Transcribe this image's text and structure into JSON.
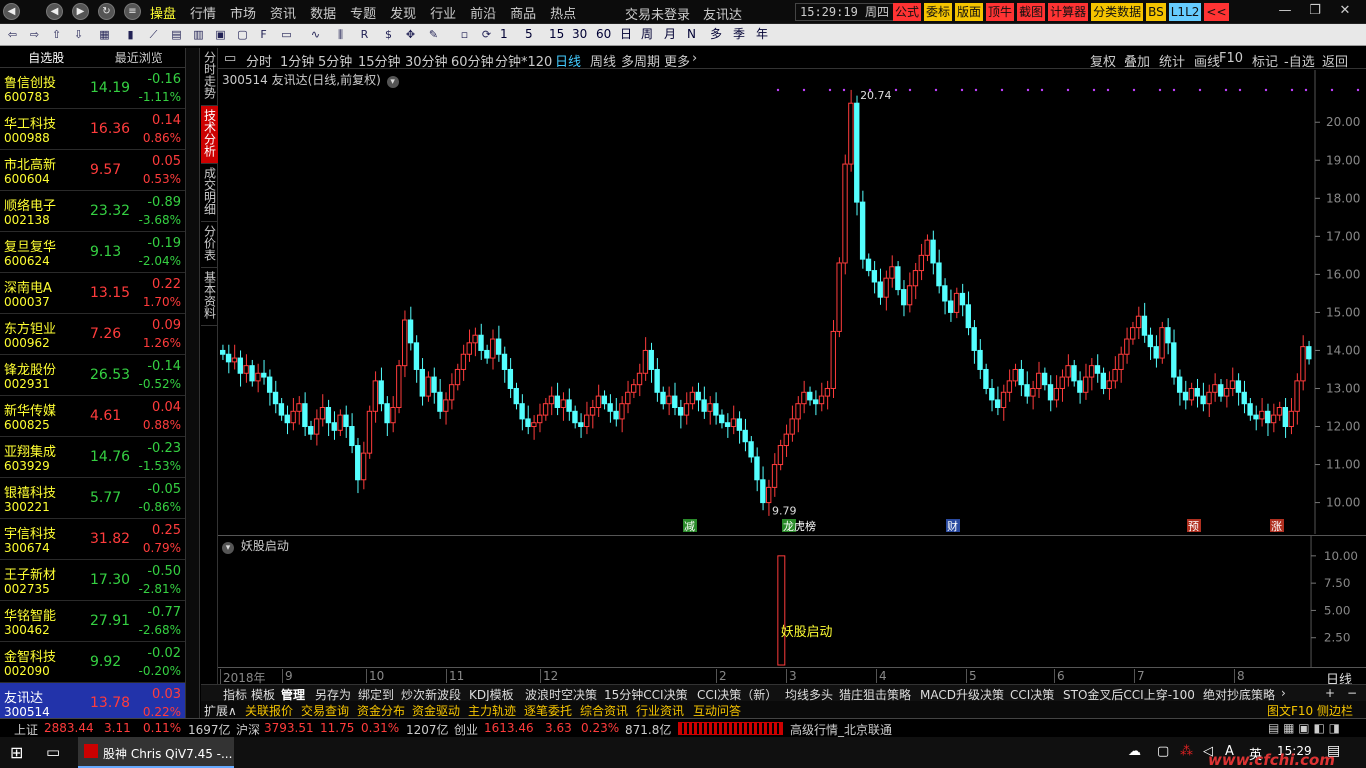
{
  "topmenu": {
    "items": [
      "操盘",
      "行情",
      "市场",
      "资讯",
      "数据",
      "专题",
      "发现",
      "行业",
      "前沿",
      "商品",
      "热点"
    ],
    "active": 0,
    "trade_status": "交易未登录",
    "stock_name": "友讯达",
    "clock": "15:29:19 周四",
    "quick": [
      "公式",
      "委标",
      "版面",
      "顶牛",
      "截图",
      "计算器",
      "分类数据",
      "BS",
      "L1L2",
      "<<"
    ]
  },
  "toolbar": {
    "text_items": [
      "1",
      "5",
      "15",
      "30",
      "60",
      "日",
      "周",
      "月",
      "N",
      "多",
      "季",
      "年"
    ]
  },
  "stocklist": {
    "header": [
      "自选股",
      "最近浏览"
    ],
    "rows": [
      {
        "name": "鲁信创投",
        "code": "600783",
        "price": "14.19",
        "change": "-0.16",
        "pct": "-1.11%",
        "dir": "dn"
      },
      {
        "name": "华工科技",
        "code": "000988",
        "price": "16.36",
        "change": "0.14",
        "pct": "0.86%",
        "dir": "up"
      },
      {
        "name": "市北高新",
        "code": "600604",
        "price": "9.57",
        "change": "0.05",
        "pct": "0.53%",
        "dir": "up"
      },
      {
        "name": "顺络电子",
        "code": "002138",
        "price": "23.32",
        "change": "-0.89",
        "pct": "-3.68%",
        "dir": "dn"
      },
      {
        "name": "复旦复华",
        "code": "600624",
        "price": "9.13",
        "change": "-0.19",
        "pct": "-2.04%",
        "dir": "dn"
      },
      {
        "name": "深南电A",
        "code": "000037",
        "price": "13.15",
        "change": "0.22",
        "pct": "1.70%",
        "dir": "up"
      },
      {
        "name": "东方钽业",
        "code": "000962",
        "price": "7.26",
        "change": "0.09",
        "pct": "1.26%",
        "dir": "up"
      },
      {
        "name": "锋龙股份",
        "code": "002931",
        "price": "26.53",
        "change": "-0.14",
        "pct": "-0.52%",
        "dir": "dn"
      },
      {
        "name": "新华传媒",
        "code": "600825",
        "price": "4.61",
        "change": "0.04",
        "pct": "0.88%",
        "dir": "up"
      },
      {
        "name": "亚翔集成",
        "code": "603929",
        "price": "14.76",
        "change": "-0.23",
        "pct": "-1.53%",
        "dir": "dn"
      },
      {
        "name": "银禧科技",
        "code": "300221",
        "price": "5.77",
        "change": "-0.05",
        "pct": "-0.86%",
        "dir": "dn"
      },
      {
        "name": "宇信科技",
        "code": "300674",
        "price": "31.82",
        "change": "0.25",
        "pct": "0.79%",
        "dir": "up"
      },
      {
        "name": "王子新材",
        "code": "002735",
        "price": "17.30",
        "change": "-0.50",
        "pct": "-2.81%",
        "dir": "dn"
      },
      {
        "name": "华铭智能",
        "code": "300462",
        "price": "27.91",
        "change": "-0.77",
        "pct": "-2.68%",
        "dir": "dn"
      },
      {
        "name": "金智科技",
        "code": "002090",
        "price": "9.92",
        "change": "-0.02",
        "pct": "-0.20%",
        "dir": "dn"
      },
      {
        "name": "友讯达",
        "code": "300514",
        "price": "13.78",
        "change": "0.03",
        "pct": "0.22%",
        "dir": "up"
      }
    ],
    "selected": 15
  },
  "vtabs": [
    {
      "label": "分时走势",
      "active": false
    },
    {
      "label": "技术分析",
      "active": true
    },
    {
      "label": "成交明细",
      "active": false
    },
    {
      "label": "分价表",
      "active": false
    },
    {
      "label": "基本资料",
      "active": false
    }
  ],
  "periods": {
    "items": [
      "分时",
      "1分钟",
      "5分钟",
      "15分钟",
      "30分钟",
      "60分钟",
      "分钟*120",
      "日线",
      "周线",
      "多周期",
      "更多"
    ],
    "active": 7,
    "right_tools": [
      "复权",
      "叠加",
      "统计",
      "画线",
      "F10",
      "标记",
      "-自选",
      "返回"
    ]
  },
  "chart": {
    "title": "300514 友讯达(日线,前复权)",
    "sub_title": "妖股启动",
    "sub_label": "妖股启动",
    "max_label": "20.74",
    "min_label": "9.79",
    "markers": [
      {
        "text": "减",
        "x": 53,
        "color": "#2a8a2a"
      },
      {
        "text": "龙虎榜",
        "x": 152,
        "color": "#2a8a2a"
      },
      {
        "text": "财",
        "x": 316,
        "color": "#2a4aa0"
      },
      {
        "text": "预",
        "x": 557,
        "color": "#b03020"
      },
      {
        "text": "涨",
        "x": 640,
        "color": "#b03020"
      }
    ]
  },
  "chart_data": {
    "type": "candlestick",
    "ylim": [
      9.7,
      20.9
    ],
    "yticks": [
      "20.00",
      "19.00",
      "18.00",
      "17.00",
      "16.00",
      "15.00",
      "14.00",
      "13.00",
      "12.00",
      "11.00",
      "10.00"
    ],
    "sub_yticks": [
      "10.00",
      "7.50",
      "5.00",
      "2.50"
    ],
    "x_labels": [
      "2018年",
      "9",
      "10",
      "11",
      "12",
      "2",
      "3",
      "4",
      "5",
      "6",
      "7",
      "8"
    ],
    "close_path": [
      13.9,
      13.7,
      13.8,
      13.4,
      13.6,
      13.2,
      13.4,
      13.3,
      12.9,
      12.6,
      12.3,
      12.1,
      12.4,
      12.6,
      12.0,
      11.8,
      12.2,
      12.5,
      12.1,
      11.9,
      12.3,
      12.0,
      11.5,
      10.6,
      11.3,
      12.4,
      13.2,
      12.6,
      12.1,
      12.5,
      13.6,
      14.8,
      14.2,
      13.5,
      12.8,
      13.3,
      12.9,
      12.4,
      12.7,
      13.1,
      13.5,
      13.9,
      14.2,
      14.4,
      14.0,
      13.8,
      14.3,
      13.9,
      13.5,
      13.0,
      12.6,
      12.2,
      12.0,
      12.1,
      12.3,
      12.6,
      12.8,
      12.5,
      12.7,
      12.4,
      12.1,
      12.0,
      12.3,
      12.5,
      12.8,
      12.6,
      12.4,
      12.2,
      12.6,
      12.9,
      13.1,
      13.4,
      14.0,
      13.5,
      12.9,
      12.6,
      12.8,
      12.5,
      12.3,
      12.6,
      12.9,
      12.7,
      12.4,
      12.6,
      12.3,
      12.1,
      12.0,
      12.2,
      11.9,
      11.6,
      11.2,
      10.6,
      10.0,
      10.4,
      11.0,
      11.5,
      11.8,
      12.2,
      12.6,
      12.9,
      12.7,
      12.6,
      12.8,
      13.0,
      14.5,
      16.3,
      18.9,
      20.5,
      17.9,
      16.4,
      16.1,
      15.8,
      15.4,
      15.9,
      16.2,
      15.6,
      15.2,
      15.7,
      16.1,
      16.5,
      16.9,
      16.3,
      15.7,
      15.3,
      15.0,
      15.5,
      15.2,
      14.6,
      14.0,
      13.5,
      13.0,
      12.7,
      12.5,
      12.9,
      13.2,
      13.5,
      13.1,
      12.8,
      13.0,
      13.4,
      13.1,
      12.7,
      13.0,
      13.3,
      13.6,
      13.2,
      12.9,
      13.3,
      13.6,
      13.4,
      13.0,
      13.2,
      13.5,
      13.9,
      14.3,
      14.6,
      14.9,
      14.4,
      14.1,
      13.8,
      14.6,
      14.2,
      13.3,
      12.9,
      12.7,
      13.0,
      12.8,
      12.6,
      12.9,
      13.1,
      12.8,
      13.0,
      13.2,
      12.9,
      12.6,
      12.3,
      12.2,
      12.4,
      12.1,
      12.3,
      12.5,
      12.0,
      12.4,
      13.2,
      14.1,
      13.78
    ]
  },
  "stratbar": {
    "items": [
      "指标",
      "模板",
      "管理",
      "另存为",
      "绑定到",
      "炒次新波段",
      "KDJ模板",
      "波浪时空决策",
      "15分钟CCI决策",
      "CCI决策（新）",
      "均线多头",
      "猎庄狙击策略",
      "MACD升级决策",
      "CCI决策",
      "STO金叉后CCI上穿-100",
      "绝对抄底策略"
    ],
    "row2": [
      "扩展∧",
      "关联报价",
      "交易查询",
      "资金分布",
      "资金驱动",
      "主力轨迹",
      "逐笔委托",
      "综合资讯",
      "行业资讯",
      "互动问答"
    ],
    "right": "图文F10",
    "right2": "侧边栏",
    "tab": "日线"
  },
  "ticker": {
    "sh_label": "上证",
    "sh_value": "2883.44",
    "sh_change": "3.11",
    "sh_pct": "0.11%",
    "sh_amount": "1697亿",
    "sz_label": "沪深",
    "sz_value": "3793.51",
    "sz_change": "11.75",
    "sz_pct": "0.31%",
    "sz_amount": "1207亿",
    "cy_label": "创业",
    "cy_value": "1613.46",
    "cy_change": "3.63",
    "cy_pct": "0.23%",
    "cy_amount": "871.8亿",
    "quote_src": "高级行情_北京联通"
  },
  "taskbar": {
    "app_title": "股神 Chris QiV7.45 -...",
    "ime": "英",
    "time": "15:29",
    "watermark": "www.cfchi.com"
  }
}
